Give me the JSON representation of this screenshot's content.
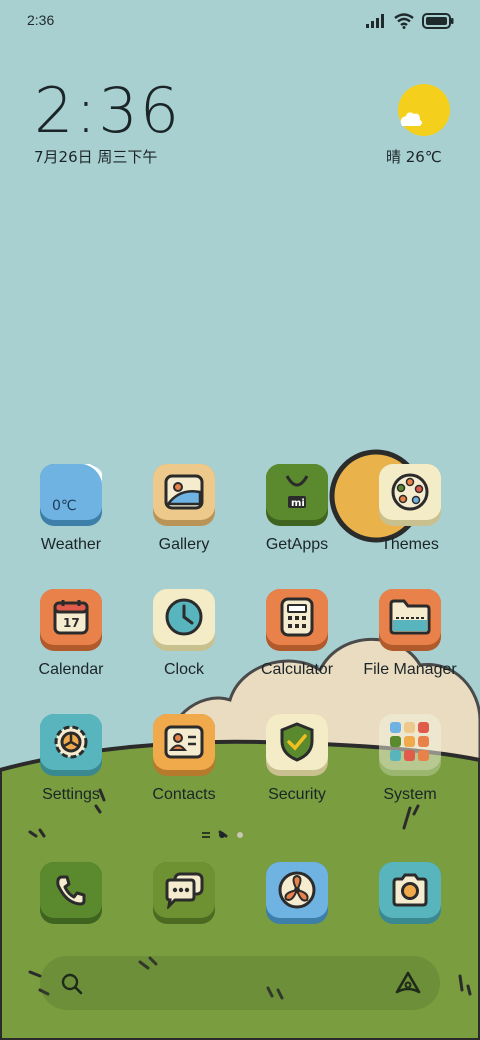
{
  "status_bar": {
    "time": "2:36",
    "icons": [
      "signal-icon",
      "wifi-icon",
      "battery-icon"
    ]
  },
  "clock": {
    "time": "2:36",
    "date": "7月26日 周三下午"
  },
  "weather": {
    "text": "晴 26℃",
    "icon": "sun-cloud-icon"
  },
  "apps": [
    {
      "label": "Weather",
      "icon": "weather-icon",
      "badge_text": "0℃",
      "color": "#6fb3e3"
    },
    {
      "label": "Gallery",
      "icon": "gallery-icon",
      "color": "#edc98b"
    },
    {
      "label": "GetApps",
      "icon": "getapps-bag-icon",
      "badge_text": "mi",
      "color": "#5b8a2e"
    },
    {
      "label": "Themes",
      "icon": "themes-palette-icon",
      "color": "#f3ecc7"
    },
    {
      "label": "Calendar",
      "icon": "calendar-icon",
      "badge_text": "17",
      "color": "#e8824a"
    },
    {
      "label": "Clock",
      "icon": "clock-icon",
      "color": "#f3ecc7"
    },
    {
      "label": "Calculator",
      "icon": "calculator-icon",
      "color": "#e8824a"
    },
    {
      "label": "File Manager",
      "icon": "folder-icon",
      "color": "#e8824a"
    },
    {
      "label": "Settings",
      "icon": "gear-icon",
      "color": "#58b5be"
    },
    {
      "label": "Contacts",
      "icon": "contact-card-icon",
      "color": "#f0a94b"
    },
    {
      "label": "Security",
      "icon": "shield-check-icon",
      "color": "#f3ecc7"
    },
    {
      "label": "System",
      "icon": "folder-grid-icon",
      "color": "#cfd2b4"
    }
  ],
  "dock": [
    {
      "name": "phone",
      "icon": "phone-icon",
      "color": "#5b8a2e"
    },
    {
      "name": "messages",
      "icon": "message-bubbles-icon",
      "color": "#6e9132"
    },
    {
      "name": "browser",
      "icon": "fan-browser-icon",
      "color": "#6fb3e3"
    },
    {
      "name": "camera",
      "icon": "camera-icon",
      "color": "#58b5be"
    }
  ],
  "search_bar": {
    "left_icon": "search-icon",
    "right_icon": "assistant-icon"
  },
  "colors": {
    "sky": "#a9d0d1",
    "grass": "#7a9e3f",
    "cloud": "#eadcc0",
    "sun": "#f2c21a",
    "outline": "#2b2b2b"
  }
}
